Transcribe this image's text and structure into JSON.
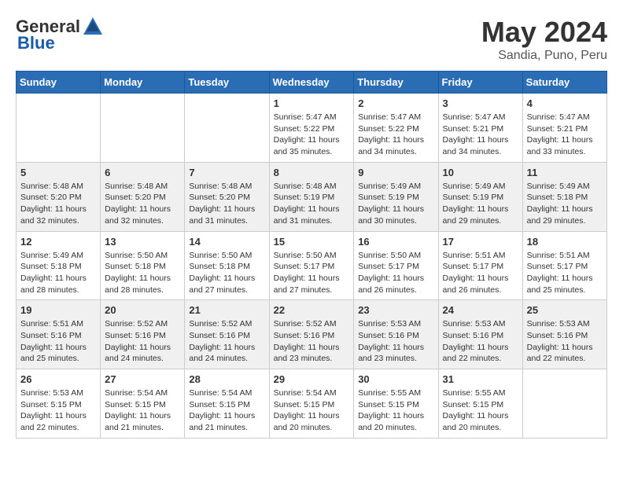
{
  "header": {
    "logo_general": "General",
    "logo_blue": "Blue",
    "month_year": "May 2024",
    "location": "Sandia, Puno, Peru"
  },
  "weekdays": [
    "Sunday",
    "Monday",
    "Tuesday",
    "Wednesday",
    "Thursday",
    "Friday",
    "Saturday"
  ],
  "weeks": [
    [
      {
        "day": "",
        "info": ""
      },
      {
        "day": "",
        "info": ""
      },
      {
        "day": "",
        "info": ""
      },
      {
        "day": "1",
        "info": "Sunrise: 5:47 AM\nSunset: 5:22 PM\nDaylight: 11 hours\nand 35 minutes."
      },
      {
        "day": "2",
        "info": "Sunrise: 5:47 AM\nSunset: 5:22 PM\nDaylight: 11 hours\nand 34 minutes."
      },
      {
        "day": "3",
        "info": "Sunrise: 5:47 AM\nSunset: 5:21 PM\nDaylight: 11 hours\nand 34 minutes."
      },
      {
        "day": "4",
        "info": "Sunrise: 5:47 AM\nSunset: 5:21 PM\nDaylight: 11 hours\nand 33 minutes."
      }
    ],
    [
      {
        "day": "5",
        "info": "Sunrise: 5:48 AM\nSunset: 5:20 PM\nDaylight: 11 hours\nand 32 minutes."
      },
      {
        "day": "6",
        "info": "Sunrise: 5:48 AM\nSunset: 5:20 PM\nDaylight: 11 hours\nand 32 minutes."
      },
      {
        "day": "7",
        "info": "Sunrise: 5:48 AM\nSunset: 5:20 PM\nDaylight: 11 hours\nand 31 minutes."
      },
      {
        "day": "8",
        "info": "Sunrise: 5:48 AM\nSunset: 5:19 PM\nDaylight: 11 hours\nand 31 minutes."
      },
      {
        "day": "9",
        "info": "Sunrise: 5:49 AM\nSunset: 5:19 PM\nDaylight: 11 hours\nand 30 minutes."
      },
      {
        "day": "10",
        "info": "Sunrise: 5:49 AM\nSunset: 5:19 PM\nDaylight: 11 hours\nand 29 minutes."
      },
      {
        "day": "11",
        "info": "Sunrise: 5:49 AM\nSunset: 5:18 PM\nDaylight: 11 hours\nand 29 minutes."
      }
    ],
    [
      {
        "day": "12",
        "info": "Sunrise: 5:49 AM\nSunset: 5:18 PM\nDaylight: 11 hours\nand 28 minutes."
      },
      {
        "day": "13",
        "info": "Sunrise: 5:50 AM\nSunset: 5:18 PM\nDaylight: 11 hours\nand 28 minutes."
      },
      {
        "day": "14",
        "info": "Sunrise: 5:50 AM\nSunset: 5:18 PM\nDaylight: 11 hours\nand 27 minutes."
      },
      {
        "day": "15",
        "info": "Sunrise: 5:50 AM\nSunset: 5:17 PM\nDaylight: 11 hours\nand 27 minutes."
      },
      {
        "day": "16",
        "info": "Sunrise: 5:50 AM\nSunset: 5:17 PM\nDaylight: 11 hours\nand 26 minutes."
      },
      {
        "day": "17",
        "info": "Sunrise: 5:51 AM\nSunset: 5:17 PM\nDaylight: 11 hours\nand 26 minutes."
      },
      {
        "day": "18",
        "info": "Sunrise: 5:51 AM\nSunset: 5:17 PM\nDaylight: 11 hours\nand 25 minutes."
      }
    ],
    [
      {
        "day": "19",
        "info": "Sunrise: 5:51 AM\nSunset: 5:16 PM\nDaylight: 11 hours\nand 25 minutes."
      },
      {
        "day": "20",
        "info": "Sunrise: 5:52 AM\nSunset: 5:16 PM\nDaylight: 11 hours\nand 24 minutes."
      },
      {
        "day": "21",
        "info": "Sunrise: 5:52 AM\nSunset: 5:16 PM\nDaylight: 11 hours\nand 24 minutes."
      },
      {
        "day": "22",
        "info": "Sunrise: 5:52 AM\nSunset: 5:16 PM\nDaylight: 11 hours\nand 23 minutes."
      },
      {
        "day": "23",
        "info": "Sunrise: 5:53 AM\nSunset: 5:16 PM\nDaylight: 11 hours\nand 23 minutes."
      },
      {
        "day": "24",
        "info": "Sunrise: 5:53 AM\nSunset: 5:16 PM\nDaylight: 11 hours\nand 22 minutes."
      },
      {
        "day": "25",
        "info": "Sunrise: 5:53 AM\nSunset: 5:16 PM\nDaylight: 11 hours\nand 22 minutes."
      }
    ],
    [
      {
        "day": "26",
        "info": "Sunrise: 5:53 AM\nSunset: 5:15 PM\nDaylight: 11 hours\nand 22 minutes."
      },
      {
        "day": "27",
        "info": "Sunrise: 5:54 AM\nSunset: 5:15 PM\nDaylight: 11 hours\nand 21 minutes."
      },
      {
        "day": "28",
        "info": "Sunrise: 5:54 AM\nSunset: 5:15 PM\nDaylight: 11 hours\nand 21 minutes."
      },
      {
        "day": "29",
        "info": "Sunrise: 5:54 AM\nSunset: 5:15 PM\nDaylight: 11 hours\nand 20 minutes."
      },
      {
        "day": "30",
        "info": "Sunrise: 5:55 AM\nSunset: 5:15 PM\nDaylight: 11 hours\nand 20 minutes."
      },
      {
        "day": "31",
        "info": "Sunrise: 5:55 AM\nSunset: 5:15 PM\nDaylight: 11 hours\nand 20 minutes."
      },
      {
        "day": "",
        "info": ""
      }
    ]
  ]
}
